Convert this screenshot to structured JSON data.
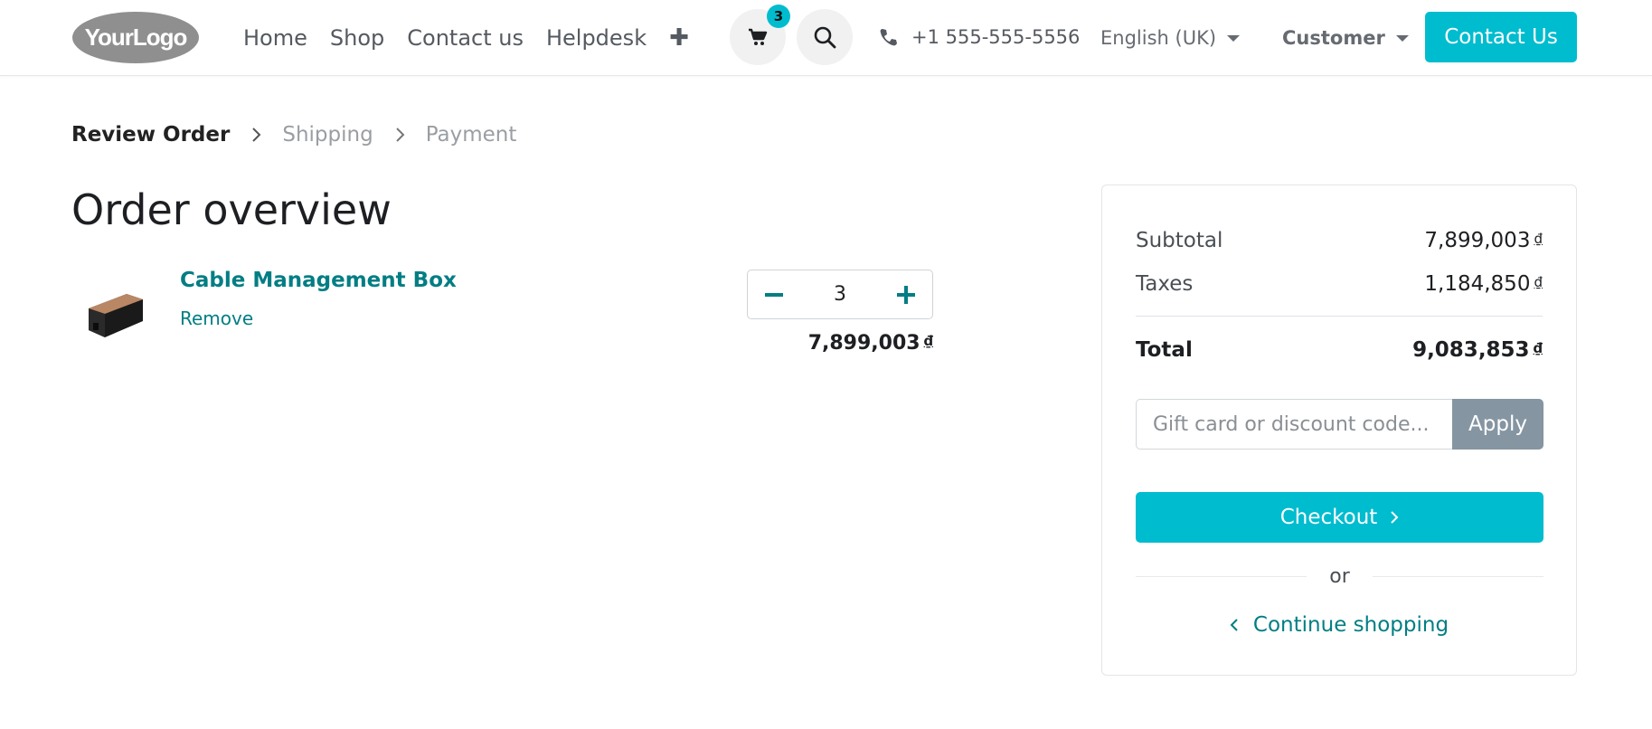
{
  "header": {
    "logo_text": "YourLogo",
    "nav": [
      "Home",
      "Shop",
      "Contact us",
      "Helpdesk"
    ],
    "plus_glyph": "✚",
    "cart_count": "3",
    "phone": "+1 555-555-5556",
    "language": "English (UK)",
    "user": "Customer",
    "contact_button": "Contact Us"
  },
  "breadcrumb": {
    "steps": [
      "Review Order",
      "Shipping",
      "Payment"
    ]
  },
  "main": {
    "title": "Order overview",
    "product": {
      "name": "Cable Management Box",
      "remove_label": "Remove",
      "quantity": "3",
      "price": "7,899,003",
      "currency": "₫"
    }
  },
  "summary": {
    "subtotal_label": "Subtotal",
    "subtotal_value": "7,899,003",
    "taxes_label": "Taxes",
    "taxes_value": "1,184,850",
    "total_label": "Total",
    "total_value": "9,083,853",
    "currency": "₫",
    "coupon_placeholder": "Gift card or discount code...",
    "apply_label": "Apply",
    "checkout_label": "Checkout",
    "or_label": "or",
    "continue_label": "Continue shopping"
  },
  "colors": {
    "accent": "#00bccf",
    "link": "#017e84",
    "apply_bg": "#8595a2"
  }
}
